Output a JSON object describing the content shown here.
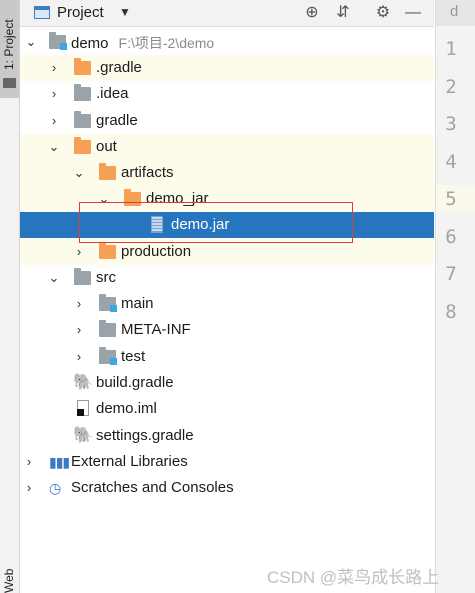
{
  "sidebar": {
    "tab_label": "1: Project",
    "bottom_label": "Web"
  },
  "header": {
    "title": "Project",
    "icons": [
      "project-view-icon",
      "locate-icon",
      "collapse-icon",
      "settings-icon",
      "hide-icon"
    ]
  },
  "editor": {
    "tab_label": "d",
    "line_numbers": [
      "1",
      "2",
      "3",
      "4",
      "5",
      "6",
      "7",
      "8"
    ]
  },
  "tree": {
    "root": {
      "label": "demo",
      "path": "F:\\项目-2\\demo"
    },
    "items": [
      {
        "label": ".gradle"
      },
      {
        "label": ".idea"
      },
      {
        "label": "gradle"
      },
      {
        "label": "out"
      },
      {
        "label": "artifacts"
      },
      {
        "label": "demo_jar"
      },
      {
        "label": "demo.jar"
      },
      {
        "label": "production"
      },
      {
        "label": "src"
      },
      {
        "label": "main"
      },
      {
        "label": "META-INF"
      },
      {
        "label": "test"
      },
      {
        "label": "build.gradle"
      },
      {
        "label": "demo.iml"
      },
      {
        "label": "settings.gradle"
      },
      {
        "label": "External Libraries"
      },
      {
        "label": "Scratches and Consoles"
      }
    ]
  },
  "colors": {
    "selection": "#2675bf",
    "folder_orange": "#f6a057",
    "folder_gray": "#9aa3a9",
    "annotation_red": "#e0393e"
  },
  "watermark": "CSDN @菜鸟成长路上"
}
